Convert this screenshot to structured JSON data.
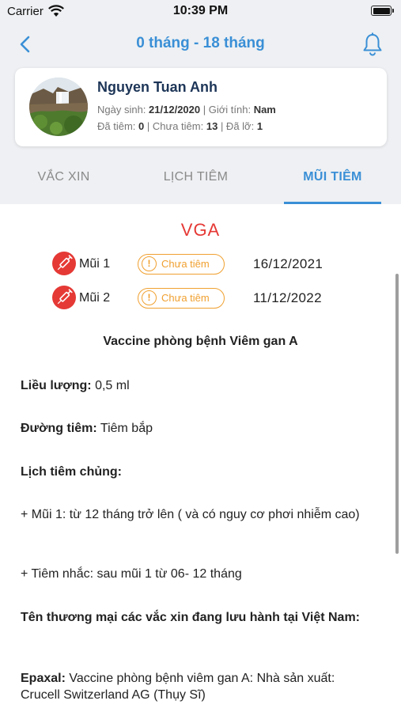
{
  "status_bar": {
    "carrier": "Carrier",
    "time": "10:39 PM"
  },
  "nav": {
    "title": "0 tháng - 18 tháng"
  },
  "profile": {
    "name": "Nguyen Tuan Anh",
    "dob_label": "Ngày sinh:",
    "dob": "21/12/2020",
    "gender_label": "| Giới tính:",
    "gender": "Nam",
    "injected_label": "Đã tiêm:",
    "injected": "0",
    "pending_label": "| Chưa tiêm:",
    "pending": "13",
    "missed_label": "| Đã lỡ:",
    "missed": "1"
  },
  "tabs": [
    {
      "label": "VẮC XIN"
    },
    {
      "label": "LỊCH TIÊM"
    },
    {
      "label": "MŨI TIÊM",
      "active": true
    }
  ],
  "vaccine": {
    "code": "VGA",
    "doses": [
      {
        "label": "Mũi 1",
        "status": "Chưa tiêm",
        "date": "16/12/2021"
      },
      {
        "label": "Mũi 2",
        "status": "Chưa tiêm",
        "date": "11/12/2022"
      }
    ],
    "title": "Vaccine phòng bệnh Viêm gan A",
    "dosage_label": "Liều lượng:",
    "dosage_value": " 0,5 ml",
    "route_label": "Đường tiêm:",
    "route_value": " Tiêm bắp",
    "schedule_label": "Lịch tiêm chủng:",
    "schedule_1": "+ Mũi 1: từ 12 tháng trở lên ( và có nguy cơ phơi nhiễm cao)",
    "schedule_2": "+ Tiêm nhắc: sau mũi 1 từ 06- 12 tháng",
    "trade_names_label": "Tên thương mại các vắc xin đang lưu hành tại Việt Nam:",
    "epaxal_label": "Epaxal:",
    "epaxal_value": " Vaccine phòng bệnh viêm gan A: Nhà sản xuất: Crucell Switzerland AG (Thụy Sĩ)"
  },
  "colors": {
    "primary": "#3a8fd6",
    "accent_red": "#e53935",
    "status_orange": "#f0a030"
  }
}
